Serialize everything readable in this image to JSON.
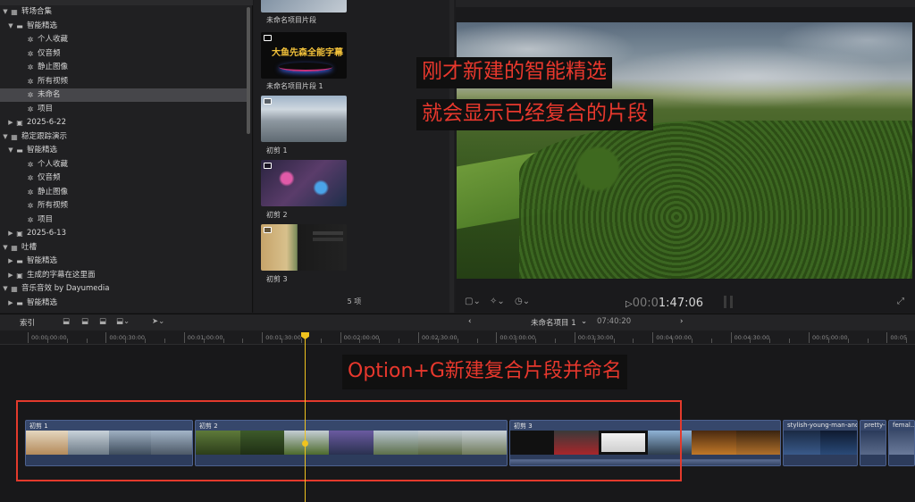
{
  "sidebar": {
    "rows": [
      {
        "label": "转场合集",
        "level": 0,
        "tri": "▼",
        "icon": "grid"
      },
      {
        "label": "智能精选",
        "level": 1,
        "tri": "▼",
        "icon": "folder"
      },
      {
        "label": "个人收藏",
        "level": 2,
        "icon": "gear"
      },
      {
        "label": "仅音频",
        "level": 2,
        "icon": "gear"
      },
      {
        "label": "静止图像",
        "level": 2,
        "icon": "gear"
      },
      {
        "label": "所有视频",
        "level": 2,
        "icon": "gear"
      },
      {
        "label": "未命名",
        "level": 2,
        "icon": "gear",
        "selected": true
      },
      {
        "label": "项目",
        "level": 2,
        "icon": "gear"
      },
      {
        "label": "2025-6-22",
        "level": 1,
        "tri": "▶",
        "icon": "event"
      },
      {
        "label": "稳定跟踪演示",
        "level": 0,
        "tri": "▼",
        "icon": "grid"
      },
      {
        "label": "智能精选",
        "level": 1,
        "tri": "▼",
        "icon": "folder"
      },
      {
        "label": "个人收藏",
        "level": 2,
        "icon": "gear"
      },
      {
        "label": "仅音频",
        "level": 2,
        "icon": "gear"
      },
      {
        "label": "静止图像",
        "level": 2,
        "icon": "gear"
      },
      {
        "label": "所有视频",
        "level": 2,
        "icon": "gear"
      },
      {
        "label": "项目",
        "level": 2,
        "icon": "gear"
      },
      {
        "label": "2025-6-13",
        "level": 1,
        "tri": "▶",
        "icon": "event"
      },
      {
        "label": "吐槽",
        "level": 0,
        "tri": "▼",
        "icon": "grid"
      },
      {
        "label": "智能精选",
        "level": 1,
        "tri": "▶",
        "icon": "folder"
      },
      {
        "label": "生成的字幕在这里面",
        "level": 1,
        "tri": "▶",
        "icon": "event"
      },
      {
        "label": "音乐音效 by Dayumedia",
        "level": 0,
        "tri": "▼",
        "icon": "grid"
      },
      {
        "label": "智能精选",
        "level": 1,
        "tri": "▶",
        "icon": "folder"
      }
    ]
  },
  "browser": {
    "items": [
      {
        "caption": "未命名项目片段",
        "kind": "partial"
      },
      {
        "caption": "未命名项目片段 1",
        "kind": "title",
        "title_text": "大鱼先森全能字幕"
      },
      {
        "caption": "初剪 1",
        "kind": "aerial"
      },
      {
        "caption": "初剪 2",
        "kind": "city"
      },
      {
        "caption": "初剪 3",
        "kind": "mixed"
      }
    ],
    "count": "5 项"
  },
  "viewer": {
    "overlay_line1": "刚才新建的智能精选",
    "overlay_line2": "就会显示已经复合的片段",
    "timecode_dim": "00:0",
    "timecode_bright": "1:47:06"
  },
  "toolbar": {
    "index_label": "索引",
    "project_name": "未命名项目 1",
    "project_chevron": "⌄",
    "duration": "07:40:20",
    "prev": "‹",
    "next": "›"
  },
  "ruler": {
    "ticks": [
      "00:00:00:00",
      "00:00:30:00",
      "00:01:00:00",
      "00:01:30:00",
      "00:02:00:00",
      "00:02:30:00",
      "00:03:00:00",
      "00:03:30:00",
      "00:04:00:00",
      "00:04:30:00",
      "00:05:00:00",
      "00:05"
    ]
  },
  "timeline": {
    "annotation": "Option+G新建复合片段并命名",
    "clips": [
      {
        "label": "初剪 1",
        "compound": true
      },
      {
        "label": "初剪 2",
        "compound": true
      },
      {
        "label": "初剪 3",
        "compound": true
      },
      {
        "label": "",
        "compound": false
      },
      {
        "label": "stylish-young-man-and...",
        "compound": false
      },
      {
        "label": "pretty-...",
        "compound": false
      },
      {
        "label": "femal...",
        "compound": false
      }
    ]
  },
  "colors": {
    "overlay_text": "#e8382d",
    "highlight_box": "#e33a2c",
    "playhead": "#f0c31e",
    "clip_fill": "#36476b"
  }
}
